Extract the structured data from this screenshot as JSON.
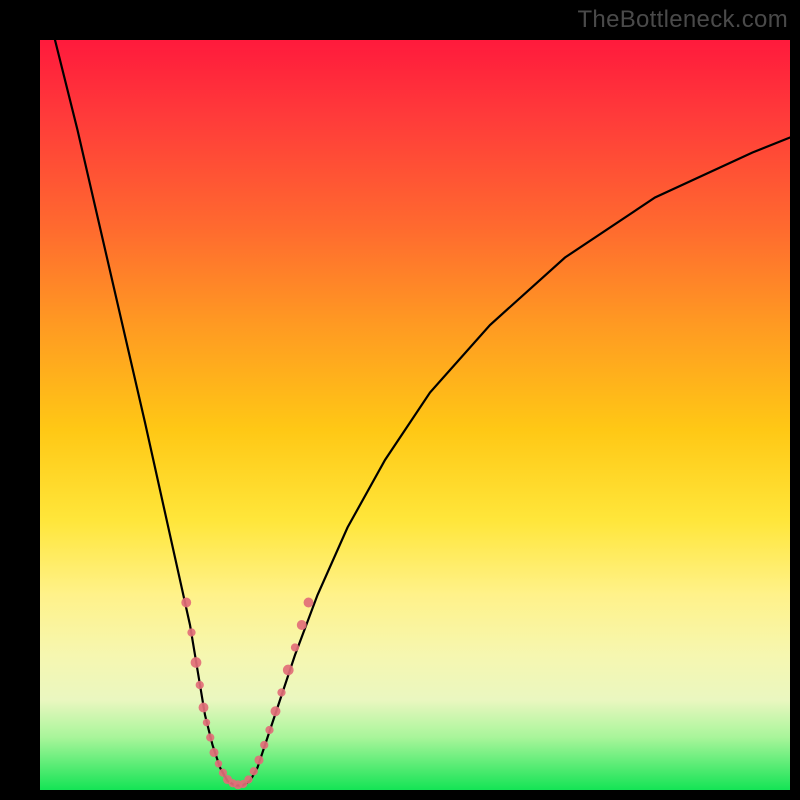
{
  "watermark": "TheBottleneck.com",
  "colors": {
    "gradient_top": "#ff1a3c",
    "gradient_mid": "#ffe63a",
    "gradient_bottom": "#14e455",
    "curve": "#000000",
    "marker": "#e26e78",
    "frame": "#000000"
  },
  "chart_data": {
    "type": "line",
    "title": "",
    "xlabel": "",
    "ylabel": "",
    "xlim": [
      0,
      100
    ],
    "ylim": [
      0,
      100
    ],
    "grid": false,
    "legend": false,
    "note": "V-shaped bottleneck curve; values below read off the normalized plot area (0 = left/bottom edge, 100 = right/top edge).",
    "curve_points": [
      {
        "x": 2,
        "y": 100
      },
      {
        "x": 5,
        "y": 88
      },
      {
        "x": 8,
        "y": 75
      },
      {
        "x": 11,
        "y": 62
      },
      {
        "x": 14,
        "y": 49
      },
      {
        "x": 16,
        "y": 40
      },
      {
        "x": 18,
        "y": 31
      },
      {
        "x": 20,
        "y": 22
      },
      {
        "x": 21,
        "y": 16
      },
      {
        "x": 22,
        "y": 10
      },
      {
        "x": 23,
        "y": 6
      },
      {
        "x": 24,
        "y": 3
      },
      {
        "x": 25,
        "y": 1.2
      },
      {
        "x": 26,
        "y": 0.6
      },
      {
        "x": 27,
        "y": 0.6
      },
      {
        "x": 28,
        "y": 1.2
      },
      {
        "x": 29,
        "y": 3
      },
      {
        "x": 30,
        "y": 6
      },
      {
        "x": 32,
        "y": 12
      },
      {
        "x": 34,
        "y": 18
      },
      {
        "x": 37,
        "y": 26
      },
      {
        "x": 41,
        "y": 35
      },
      {
        "x": 46,
        "y": 44
      },
      {
        "x": 52,
        "y": 53
      },
      {
        "x": 60,
        "y": 62
      },
      {
        "x": 70,
        "y": 71
      },
      {
        "x": 82,
        "y": 79
      },
      {
        "x": 95,
        "y": 85
      },
      {
        "x": 100,
        "y": 87
      }
    ],
    "markers": [
      {
        "x": 19.5,
        "y": 25,
        "r": 1.2
      },
      {
        "x": 20.2,
        "y": 21,
        "r": 1.0
      },
      {
        "x": 20.8,
        "y": 17,
        "r": 1.3
      },
      {
        "x": 21.3,
        "y": 14,
        "r": 1.0
      },
      {
        "x": 21.8,
        "y": 11,
        "r": 1.2
      },
      {
        "x": 22.2,
        "y": 9,
        "r": 0.9
      },
      {
        "x": 22.7,
        "y": 7,
        "r": 1.0
      },
      {
        "x": 23.2,
        "y": 5,
        "r": 1.1
      },
      {
        "x": 23.8,
        "y": 3.5,
        "r": 0.9
      },
      {
        "x": 24.4,
        "y": 2.3,
        "r": 1.0
      },
      {
        "x": 25.0,
        "y": 1.4,
        "r": 1.1
      },
      {
        "x": 25.7,
        "y": 0.9,
        "r": 1.0
      },
      {
        "x": 26.4,
        "y": 0.7,
        "r": 1.1
      },
      {
        "x": 27.1,
        "y": 0.8,
        "r": 1.0
      },
      {
        "x": 27.8,
        "y": 1.4,
        "r": 1.0
      },
      {
        "x": 28.5,
        "y": 2.5,
        "r": 1.0
      },
      {
        "x": 29.2,
        "y": 4,
        "r": 1.1
      },
      {
        "x": 29.9,
        "y": 6,
        "r": 1.0
      },
      {
        "x": 30.6,
        "y": 8,
        "r": 1.0
      },
      {
        "x": 31.4,
        "y": 10.5,
        "r": 1.2
      },
      {
        "x": 32.2,
        "y": 13,
        "r": 1.0
      },
      {
        "x": 33.1,
        "y": 16,
        "r": 1.3
      },
      {
        "x": 34.0,
        "y": 19,
        "r": 1.0
      },
      {
        "x": 34.9,
        "y": 22,
        "r": 1.2
      },
      {
        "x": 35.8,
        "y": 25,
        "r": 1.2
      }
    ]
  }
}
